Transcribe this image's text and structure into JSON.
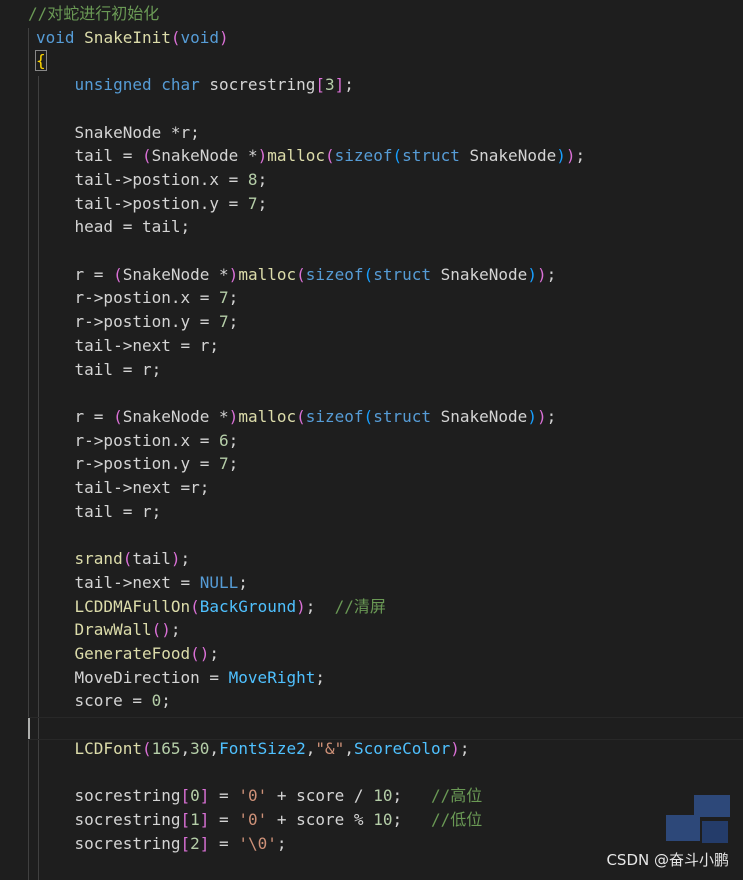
{
  "colors": {
    "background": "#1e1e1e",
    "comment": "#6a9955",
    "keyword": "#569cd6",
    "function": "#dcdcaa",
    "number": "#b5cea8",
    "string": "#ce9178",
    "macro": "#4fc1ff",
    "paren_level1": "#da70d6",
    "paren_level2": "#179fff",
    "plain": "#d4d4d4",
    "brace": "#ffd700"
  },
  "watermark": {
    "text": "CSDN @奋斗小鹏"
  },
  "code_lines": [
    [
      [
        "comment",
        "//对蛇进行初始化"
      ]
    ],
    [
      [
        "keyword",
        "void"
      ],
      [
        "plain",
        " "
      ],
      [
        "func",
        "SnakeInit"
      ],
      [
        "paren1",
        "("
      ],
      [
        "keyword",
        "void"
      ],
      [
        "paren1",
        ")"
      ]
    ],
    [
      [
        "brace",
        "{"
      ]
    ],
    [
      [
        "plain",
        "    "
      ],
      [
        "keyword",
        "unsigned"
      ],
      [
        "plain",
        " "
      ],
      [
        "keyword",
        "char"
      ],
      [
        "plain",
        " socrestring"
      ],
      [
        "paren1",
        "["
      ],
      [
        "number",
        "3"
      ],
      [
        "paren1",
        "]"
      ],
      [
        "plain",
        ";"
      ]
    ],
    [],
    [
      [
        "plain",
        "    SnakeNode *r;"
      ]
    ],
    [
      [
        "plain",
        "    tail = "
      ],
      [
        "paren1",
        "("
      ],
      [
        "plain",
        "SnakeNode *"
      ],
      [
        "paren1",
        ")"
      ],
      [
        "func",
        "malloc"
      ],
      [
        "paren1",
        "("
      ],
      [
        "keyword",
        "sizeof"
      ],
      [
        "paren2",
        "("
      ],
      [
        "keyword",
        "struct"
      ],
      [
        "plain",
        " SnakeNode"
      ],
      [
        "paren2",
        ")"
      ],
      [
        "paren1",
        ")"
      ],
      [
        "plain",
        ";"
      ]
    ],
    [
      [
        "plain",
        "    tail->postion.x = "
      ],
      [
        "number",
        "8"
      ],
      [
        "plain",
        ";"
      ]
    ],
    [
      [
        "plain",
        "    tail->postion.y = "
      ],
      [
        "number",
        "7"
      ],
      [
        "plain",
        ";"
      ]
    ],
    [
      [
        "plain",
        "    head = tail;"
      ]
    ],
    [],
    [
      [
        "plain",
        "    r = "
      ],
      [
        "paren1",
        "("
      ],
      [
        "plain",
        "SnakeNode *"
      ],
      [
        "paren1",
        ")"
      ],
      [
        "func",
        "malloc"
      ],
      [
        "paren1",
        "("
      ],
      [
        "keyword",
        "sizeof"
      ],
      [
        "paren2",
        "("
      ],
      [
        "keyword",
        "struct"
      ],
      [
        "plain",
        " SnakeNode"
      ],
      [
        "paren2",
        ")"
      ],
      [
        "paren1",
        ")"
      ],
      [
        "plain",
        ";"
      ]
    ],
    [
      [
        "plain",
        "    r->postion.x = "
      ],
      [
        "number",
        "7"
      ],
      [
        "plain",
        ";"
      ]
    ],
    [
      [
        "plain",
        "    r->postion.y = "
      ],
      [
        "number",
        "7"
      ],
      [
        "plain",
        ";"
      ]
    ],
    [
      [
        "plain",
        "    tail->next = r;"
      ]
    ],
    [
      [
        "plain",
        "    tail = r;"
      ]
    ],
    [],
    [
      [
        "plain",
        "    r = "
      ],
      [
        "paren1",
        "("
      ],
      [
        "plain",
        "SnakeNode *"
      ],
      [
        "paren1",
        ")"
      ],
      [
        "func",
        "malloc"
      ],
      [
        "paren1",
        "("
      ],
      [
        "keyword",
        "sizeof"
      ],
      [
        "paren2",
        "("
      ],
      [
        "keyword",
        "struct"
      ],
      [
        "plain",
        " SnakeNode"
      ],
      [
        "paren2",
        ")"
      ],
      [
        "paren1",
        ")"
      ],
      [
        "plain",
        ";"
      ]
    ],
    [
      [
        "plain",
        "    r->postion.x = "
      ],
      [
        "number",
        "6"
      ],
      [
        "plain",
        ";"
      ]
    ],
    [
      [
        "plain",
        "    r->postion.y = "
      ],
      [
        "number",
        "7"
      ],
      [
        "plain",
        ";"
      ]
    ],
    [
      [
        "plain",
        "    tail->next =r;"
      ]
    ],
    [
      [
        "plain",
        "    tail = r;"
      ]
    ],
    [],
    [
      [
        "plain",
        "    "
      ],
      [
        "func",
        "srand"
      ],
      [
        "paren1",
        "("
      ],
      [
        "plain",
        "tail"
      ],
      [
        "paren1",
        ")"
      ],
      [
        "plain",
        ";"
      ]
    ],
    [
      [
        "plain",
        "    tail->next = "
      ],
      [
        "keyword",
        "NULL"
      ],
      [
        "plain",
        ";"
      ]
    ],
    [
      [
        "plain",
        "    "
      ],
      [
        "func",
        "LCDDMAFullOn"
      ],
      [
        "paren1",
        "("
      ],
      [
        "macro",
        "BackGround"
      ],
      [
        "paren1",
        ")"
      ],
      [
        "plain",
        ";  "
      ],
      [
        "comment",
        "//清屏"
      ]
    ],
    [
      [
        "plain",
        "    "
      ],
      [
        "func",
        "DrawWall"
      ],
      [
        "paren1",
        "()"
      ],
      [
        "plain",
        ";"
      ]
    ],
    [
      [
        "plain",
        "    "
      ],
      [
        "func",
        "GenerateFood"
      ],
      [
        "paren1",
        "()"
      ],
      [
        "plain",
        ";"
      ]
    ],
    [
      [
        "plain",
        "    MoveDirection = "
      ],
      [
        "macro",
        "MoveRight"
      ],
      [
        "plain",
        ";"
      ]
    ],
    [
      [
        "plain",
        "    score = "
      ],
      [
        "number",
        "0"
      ],
      [
        "plain",
        ";"
      ]
    ],
    [],
    [
      [
        "plain",
        "    "
      ],
      [
        "func",
        "LCDFont"
      ],
      [
        "paren1",
        "("
      ],
      [
        "number",
        "165"
      ],
      [
        "plain",
        ","
      ],
      [
        "number",
        "30"
      ],
      [
        "plain",
        ","
      ],
      [
        "macro",
        "FontSize2"
      ],
      [
        "plain",
        ","
      ],
      [
        "string",
        "\"&\""
      ],
      [
        "plain",
        ","
      ],
      [
        "macro",
        "ScoreColor"
      ],
      [
        "paren1",
        ")"
      ],
      [
        "plain",
        ";"
      ]
    ],
    [],
    [
      [
        "plain",
        "    socrestring"
      ],
      [
        "paren1",
        "["
      ],
      [
        "number",
        "0"
      ],
      [
        "paren1",
        "]"
      ],
      [
        "plain",
        " = "
      ],
      [
        "string",
        "'0'"
      ],
      [
        "plain",
        " + score / "
      ],
      [
        "number",
        "10"
      ],
      [
        "plain",
        ";   "
      ],
      [
        "comment",
        "//高位"
      ]
    ],
    [
      [
        "plain",
        "    socrestring"
      ],
      [
        "paren1",
        "["
      ],
      [
        "number",
        "1"
      ],
      [
        "paren1",
        "]"
      ],
      [
        "plain",
        " = "
      ],
      [
        "string",
        "'0'"
      ],
      [
        "plain",
        " + score % "
      ],
      [
        "number",
        "10"
      ],
      [
        "plain",
        ";   "
      ],
      [
        "comment",
        "//低位"
      ]
    ],
    [
      [
        "plain",
        "    socrestring"
      ],
      [
        "paren1",
        "["
      ],
      [
        "number",
        "2"
      ],
      [
        "paren1",
        "]"
      ],
      [
        "plain",
        " = "
      ],
      [
        "string",
        "'\\0'"
      ],
      [
        "plain",
        ";"
      ]
    ]
  ]
}
